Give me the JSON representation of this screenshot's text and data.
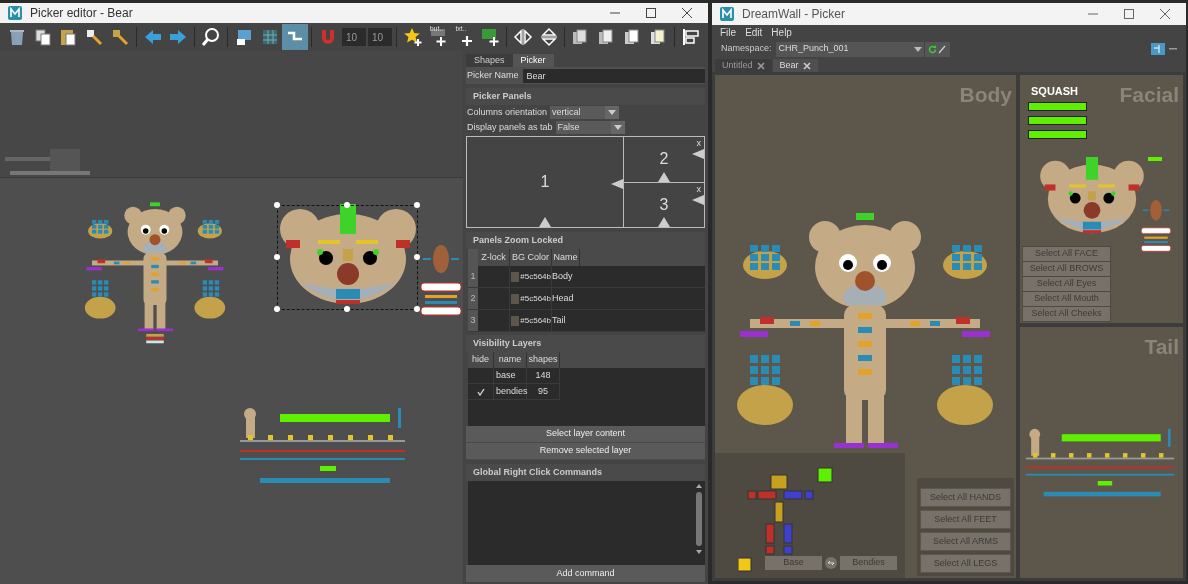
{
  "editor": {
    "title": "Picker editor - Bear",
    "toolbar": [
      [
        {
          "kind": "button",
          "selected": false
        },
        {
          "kind": "button",
          "selected": false
        },
        {
          "kind": "button",
          "selected": false
        },
        {
          "kind": "button",
          "selected": false
        },
        {
          "kind": "button",
          "selected": false
        }
      ],
      [
        {
          "kind": "button",
          "selected": false
        },
        {
          "kind": "button",
          "selected": false
        }
      ],
      [
        {
          "kind": "button",
          "selected": false
        }
      ],
      [
        {
          "kind": "button",
          "selected": false
        },
        {
          "kind": "button",
          "selected": false
        },
        {
          "kind": "button",
          "selected": true
        }
      ],
      [
        {
          "kind": "button",
          "selected": false
        },
        {
          "kind": "field",
          "value": "10"
        },
        {
          "kind": "field",
          "value": "10"
        }
      ],
      [
        {
          "kind": "button",
          "selected": false
        },
        {
          "kind": "button",
          "selected": false,
          "label": "but.."
        },
        {
          "kind": "button",
          "selected": false,
          "label": "txt.."
        },
        {
          "kind": "button",
          "selected": false
        }
      ],
      [
        {
          "kind": "button",
          "selected": false
        },
        {
          "kind": "button",
          "selected": false
        }
      ],
      [
        {
          "kind": "button",
          "selected": false
        },
        {
          "kind": "button",
          "selected": false
        },
        {
          "kind": "button",
          "selected": false
        },
        {
          "kind": "button",
          "selected": false
        }
      ],
      [
        {
          "kind": "button",
          "selected": false
        }
      ]
    ],
    "panel": {
      "tabs": [
        {
          "label": "Shapes",
          "selected": false
        },
        {
          "label": "Picker",
          "selected": true
        }
      ],
      "picker_name": {
        "label": "Picker Name",
        "value": "Bear"
      },
      "picker_panels": {
        "title": "Picker Panels",
        "fields": [
          {
            "label": "Columns orientation",
            "value": "vertical"
          },
          {
            "label": "Display panels as tab",
            "value": "False"
          }
        ],
        "layout": [
          {
            "number": "1"
          },
          {
            "number": "2",
            "close": "x"
          },
          {
            "number": "3",
            "close": "x"
          }
        ]
      },
      "zoom_locked": {
        "title": "Panels Zoom Locked",
        "columns": [
          "Z-lock",
          "BG Color",
          "Name"
        ],
        "rows": [
          {
            "index": "1",
            "color": "#5c564b",
            "bg_color": "#5c564b",
            "name": "Body"
          },
          {
            "index": "2",
            "color": "#5c564b",
            "bg_color": "#5c564b",
            "name": "Head"
          },
          {
            "index": "3",
            "color": "#5c564b",
            "bg_color": "#5c564b",
            "name": "Tail"
          }
        ]
      },
      "visibility_layers": {
        "title": "Visibility Layers",
        "columns": [
          "hide",
          "name",
          "shapes"
        ],
        "rows": [
          {
            "hidden": false,
            "name": "base",
            "shapes": "148"
          },
          {
            "hidden": true,
            "name": "bendies",
            "shapes": "95"
          }
        ],
        "buttons": [
          "Select layer content",
          "Remove selected layer"
        ]
      },
      "right_click": {
        "title": "Global Right Click Commands",
        "button": "Add command"
      }
    }
  },
  "picker": {
    "title": "DreamWall - Picker",
    "menu": [
      "File",
      "Edit",
      "Help"
    ],
    "namespace": {
      "label": "Namespace:",
      "value": "CHR_Punch_001"
    },
    "tabs": [
      {
        "label": "Untitled",
        "selected": false
      },
      {
        "label": "Bear",
        "selected": true
      }
    ],
    "body": {
      "title": "Body",
      "select_buttons": [
        "Select All HANDS",
        "Select All FEET",
        "Select All ARMS",
        "Select All LEGS"
      ],
      "layer_buttons": [
        "Base",
        "Bendies"
      ]
    },
    "facial": {
      "title": "Facial",
      "squash_label": "SQUASH",
      "select_buttons": [
        "Select All FACE",
        "Select All BROWS",
        "Select All Eyes",
        "Select All Mouth",
        "Select All Cheeks"
      ]
    },
    "tail": {
      "title": "Tail"
    }
  }
}
